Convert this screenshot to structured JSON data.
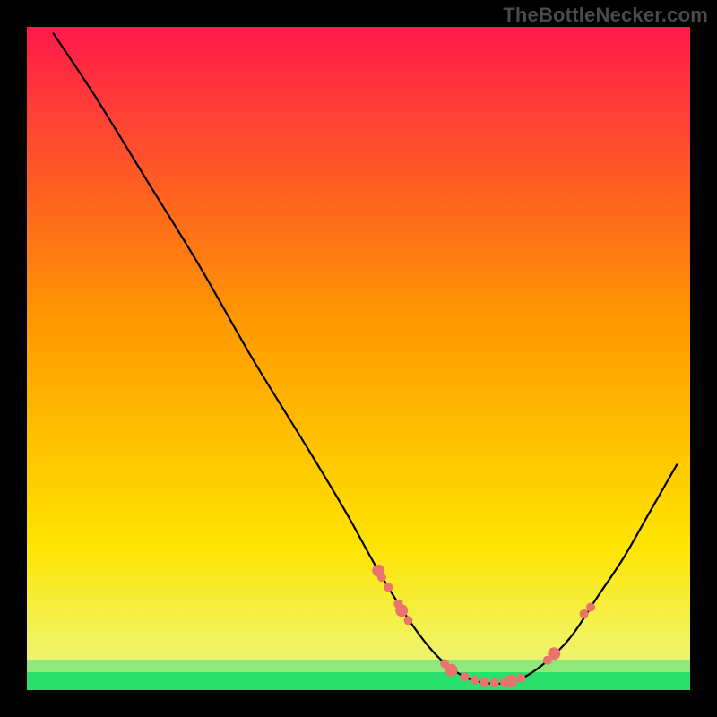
{
  "watermark": "TheBottleNecker.com",
  "chart_data": {
    "type": "line",
    "title": "",
    "xlabel": "",
    "ylabel": "",
    "xlim": [
      0,
      100
    ],
    "ylim": [
      0,
      100
    ],
    "background_gradient": {
      "top": "#ff1a4b",
      "mid": "#ffde00",
      "bottom_band": "#28e06b"
    },
    "series": [
      {
        "name": "bottleneck-curve",
        "stroke": "#000000",
        "points": [
          {
            "x": 4.0,
            "y": 99.0
          },
          {
            "x": 10.0,
            "y": 90.0
          },
          {
            "x": 18.0,
            "y": 77.0
          },
          {
            "x": 26.0,
            "y": 64.0
          },
          {
            "x": 34.0,
            "y": 50.0
          },
          {
            "x": 42.0,
            "y": 37.0
          },
          {
            "x": 48.0,
            "y": 27.0
          },
          {
            "x": 53.0,
            "y": 18.0
          },
          {
            "x": 58.0,
            "y": 10.0
          },
          {
            "x": 62.0,
            "y": 5.0
          },
          {
            "x": 66.0,
            "y": 2.0
          },
          {
            "x": 70.0,
            "y": 1.0
          },
          {
            "x": 74.0,
            "y": 1.5
          },
          {
            "x": 78.0,
            "y": 4.0
          },
          {
            "x": 82.0,
            "y": 8.0
          },
          {
            "x": 86.0,
            "y": 14.0
          },
          {
            "x": 90.0,
            "y": 20.0
          },
          {
            "x": 94.0,
            "y": 27.0
          },
          {
            "x": 98.0,
            "y": 34.0
          }
        ]
      }
    ],
    "markers": {
      "color": "#e9746e",
      "radius_small": 5,
      "radius_large": 7,
      "points": [
        {
          "x": 53.0,
          "y": 18.0,
          "r": "large"
        },
        {
          "x": 53.5,
          "y": 17.0,
          "r": "small"
        },
        {
          "x": 54.5,
          "y": 15.5,
          "r": "small"
        },
        {
          "x": 56.0,
          "y": 13.0,
          "r": "small"
        },
        {
          "x": 56.5,
          "y": 12.0,
          "r": "large"
        },
        {
          "x": 57.5,
          "y": 10.5,
          "r": "small"
        },
        {
          "x": 63.0,
          "y": 4.0,
          "r": "small"
        },
        {
          "x": 64.0,
          "y": 3.0,
          "r": "large"
        },
        {
          "x": 66.0,
          "y": 2.0,
          "r": "small"
        },
        {
          "x": 67.5,
          "y": 1.5,
          "r": "small"
        },
        {
          "x": 69.0,
          "y": 1.2,
          "r": "small"
        },
        {
          "x": 70.5,
          "y": 1.1,
          "r": "small"
        },
        {
          "x": 72.0,
          "y": 1.2,
          "r": "small"
        },
        {
          "x": 73.0,
          "y": 1.4,
          "r": "large"
        },
        {
          "x": 74.5,
          "y": 1.8,
          "r": "small"
        },
        {
          "x": 78.5,
          "y": 4.5,
          "r": "small"
        },
        {
          "x": 79.5,
          "y": 5.5,
          "r": "large"
        },
        {
          "x": 84.0,
          "y": 11.5,
          "r": "small"
        },
        {
          "x": 85.0,
          "y": 12.5,
          "r": "small"
        }
      ]
    }
  }
}
